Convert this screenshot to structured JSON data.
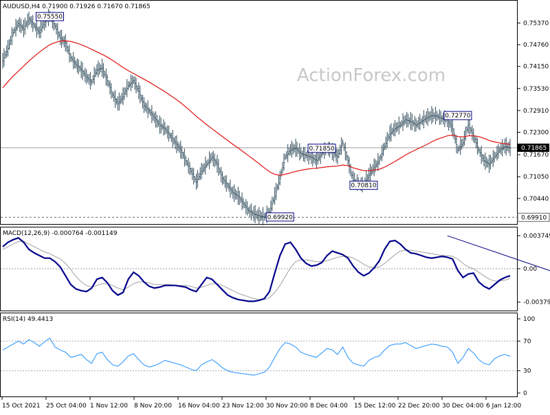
{
  "colors": {
    "bars": "#2e4a5a",
    "sma": "#e01010",
    "macd_main": "#00008b",
    "macd_signal": "#a0a0a0",
    "rsi": "#1e90ff",
    "hline": "#9a9a9a",
    "trendline": "#000080"
  },
  "watermark": "ActionForex.com",
  "chart_data": [
    {
      "type": "line",
      "title": "AUDUSD,H4  0.71900 0.71926 0.71670 0.71865",
      "x_ticks": [
        "15 Oct 2021",
        "25 Oct 04:00",
        "1 Nov 12:00",
        "8 Nov 20:00",
        "16 Nov 04:00",
        "23 Nov 12:00",
        "30 Nov 20:00",
        "8 Dec 04:00",
        "15 Dec 12:00",
        "22 Dec 20:00",
        "30 Dec 04:00",
        "6 Jan 12:00"
      ],
      "y_ticks": [
        "0.75370",
        "0.74760",
        "0.74150",
        "0.73530",
        "0.72910",
        "0.72300",
        "0.71670",
        "0.71050",
        "0.70440"
      ],
      "ylim": [
        0.698,
        0.759
      ],
      "current_price_label": "0.71865",
      "current_price": 0.71865,
      "level_label": "0.69910",
      "level": 0.6991,
      "annotations": [
        {
          "text": "0.75550",
          "x": 9,
          "y": 0.7555
        },
        {
          "text": "0.69920",
          "x": 53,
          "y": 0.6992
        },
        {
          "text": "0.71850",
          "x": 61,
          "y": 0.7185
        },
        {
          "text": "0.70810",
          "x": 69,
          "y": 0.7081
        },
        {
          "text": "0.72770",
          "x": 87,
          "y": 0.7277
        }
      ],
      "series": [
        {
          "values": [
            0.743,
            0.7465,
            0.751,
            0.7535,
            0.752,
            0.7548,
            0.753,
            0.751,
            0.754,
            0.7555,
            0.7528,
            0.7495,
            0.748,
            0.744,
            0.742,
            0.7405,
            0.7385,
            0.737,
            0.7405,
            0.741,
            0.7375,
            0.7335,
            0.731,
            0.733,
            0.736,
            0.7375,
            0.7345,
            0.7305,
            0.729,
            0.727,
            0.725,
            0.724,
            0.722,
            0.72,
            0.718,
            0.715,
            0.712,
            0.709,
            0.712,
            0.714,
            0.716,
            0.714,
            0.71,
            0.708,
            0.706,
            0.705,
            0.703,
            0.701,
            0.7,
            0.6995,
            0.6992,
            0.7005,
            0.705,
            0.71,
            0.716,
            0.718,
            0.7185,
            0.717,
            0.7165,
            0.716,
            0.715,
            0.717,
            0.7185,
            0.7175,
            0.716,
            0.72,
            0.715,
            0.7095,
            0.7085,
            0.7081,
            0.711,
            0.713,
            0.715,
            0.719,
            0.7225,
            0.724,
            0.725,
            0.7265,
            0.726,
            0.725,
            0.726,
            0.727,
            0.7277,
            0.7275,
            0.7268,
            0.7265,
            0.724,
            0.718,
            0.72,
            0.725,
            0.722,
            0.718,
            0.715,
            0.714,
            0.716,
            0.718,
            0.719,
            0.7186
          ]
        },
        {
          "values": [
            0.7355,
            0.7372,
            0.7388,
            0.7402,
            0.7416,
            0.743,
            0.7443,
            0.7455,
            0.7466,
            0.7476,
            0.7482,
            0.7486,
            0.7487,
            0.7485,
            0.7481,
            0.7476,
            0.747,
            0.7463,
            0.7456,
            0.7449,
            0.7441,
            0.7432,
            0.7422,
            0.7412,
            0.7403,
            0.7395,
            0.7387,
            0.7379,
            0.7371,
            0.7362,
            0.7353,
            0.7344,
            0.7334,
            0.7324,
            0.7313,
            0.7301,
            0.7288,
            0.7275,
            0.7263,
            0.7251,
            0.724,
            0.7229,
            0.7218,
            0.7207,
            0.7196,
            0.7186,
            0.7175,
            0.7164,
            0.7153,
            0.7142,
            0.713,
            0.7119,
            0.7112,
            0.7109,
            0.7112,
            0.7116,
            0.712,
            0.7123,
            0.7126,
            0.7128,
            0.7129,
            0.7131,
            0.7133,
            0.7134,
            0.7135,
            0.7138,
            0.7136,
            0.713,
            0.7126,
            0.7122,
            0.7122,
            0.7124,
            0.7126,
            0.7132,
            0.714,
            0.7148,
            0.7157,
            0.7166,
            0.7174,
            0.7181,
            0.7188,
            0.7195,
            0.7203,
            0.721,
            0.7215,
            0.722,
            0.7222,
            0.7218,
            0.7217,
            0.722,
            0.722,
            0.7218,
            0.7213,
            0.7207,
            0.7203,
            0.72,
            0.7198,
            0.7196
          ]
        }
      ]
    },
    {
      "type": "line",
      "title": "MACD(12,26,9) -0.000764 -0.001149",
      "y_ticks": [
        "0.003749",
        "0.00",
        "-0.003796"
      ],
      "ylim": [
        -0.0046,
        0.0043
      ],
      "trendline": [
        {
          "x": 85,
          "y": 0.00375
        },
        {
          "x": 106,
          "y": -0.0005
        }
      ],
      "series": [
        {
          "values": [
            0.0025,
            0.003,
            0.0033,
            0.0035,
            0.003,
            0.0022,
            0.0018,
            0.0015,
            0.0012,
            0.0012,
            0.0008,
            0.0002,
            -0.0008,
            -0.0018,
            -0.0023,
            -0.0025,
            -0.0026,
            -0.0022,
            -0.0012,
            -0.001,
            -0.0016,
            -0.0025,
            -0.003,
            -0.0027,
            -0.0012,
            -0.0004,
            -0.0008,
            -0.0015,
            -0.002,
            -0.0022,
            -0.0021,
            -0.0019,
            -0.0019,
            -0.0019,
            -0.002,
            -0.0021,
            -0.0024,
            -0.0026,
            -0.0018,
            -0.001,
            -0.0012,
            -0.0018,
            -0.0024,
            -0.003,
            -0.0033,
            -0.0035,
            -0.0036,
            -0.0037,
            -0.0037,
            -0.0036,
            -0.0034,
            -0.0026,
            -0.0005,
            0.0015,
            0.0028,
            0.003,
            0.0022,
            0.0012,
            0.0006,
            0.0003,
            0.0004,
            0.0007,
            0.0015,
            0.002,
            0.0018,
            0.0016,
            0.0012,
            0.0003,
            -0.0004,
            -0.0008,
            -0.0005,
            0.0001,
            0.0009,
            0.0022,
            0.0031,
            0.0032,
            0.0028,
            0.0022,
            0.0018,
            0.0017,
            0.0015,
            0.0013,
            0.0012,
            0.0013,
            0.0014,
            0.0013,
            0.0011,
            -0.0002,
            -0.001,
            -0.0006,
            -0.0005,
            -0.0015,
            -0.002,
            -0.0023,
            -0.0018,
            -0.0013,
            -0.001,
            -0.0008
          ]
        },
        {
          "values": [
            0.0022,
            0.0025,
            0.0028,
            0.0031,
            0.0031,
            0.0028,
            0.0025,
            0.0022,
            0.0019,
            0.0017,
            0.0014,
            0.0011,
            0.0006,
            -0.0001,
            -0.0009,
            -0.0015,
            -0.0019,
            -0.0021,
            -0.0019,
            -0.0017,
            -0.0017,
            -0.0019,
            -0.0022,
            -0.0024,
            -0.0021,
            -0.0017,
            -0.0015,
            -0.0015,
            -0.0016,
            -0.0018,
            -0.0018,
            -0.0018,
            -0.0018,
            -0.0019,
            -0.0019,
            -0.0019,
            -0.002,
            -0.0022,
            -0.0021,
            -0.0019,
            -0.0017,
            -0.0017,
            -0.0019,
            -0.0022,
            -0.0025,
            -0.0028,
            -0.003,
            -0.0032,
            -0.0034,
            -0.0035,
            -0.0035,
            -0.0033,
            -0.0027,
            -0.0019,
            -0.0009,
            0.0001,
            0.0008,
            0.001,
            0.001,
            0.0009,
            0.0008,
            0.0008,
            0.0009,
            0.0011,
            0.0013,
            0.0014,
            0.0014,
            0.0012,
            0.0009,
            0.0005,
            0.0002,
            0.0001,
            0.0002,
            0.0006,
            0.0011,
            0.0016,
            0.002,
            0.0021,
            0.0021,
            0.002,
            0.0019,
            0.0018,
            0.0017,
            0.0016,
            0.0015,
            0.0015,
            0.0014,
            0.0011,
            0.0006,
            0.0002,
            0.0,
            -0.0004,
            -0.0008,
            -0.0012,
            -0.0014,
            -0.0014,
            -0.0013,
            -0.0011
          ]
        }
      ]
    },
    {
      "type": "line",
      "title": "RSI(14) 49.4413",
      "y_ticks": [
        "100",
        "70",
        "30",
        "0"
      ],
      "ylim": [
        0,
        100
      ],
      "levels": [
        70,
        30
      ],
      "series": [
        {
          "values": [
            58,
            62,
            66,
            70,
            66,
            72,
            68,
            63,
            69,
            74,
            62,
            58,
            55,
            48,
            50,
            52,
            45,
            40,
            53,
            55,
            45,
            38,
            36,
            42,
            50,
            53,
            45,
            38,
            35,
            37,
            40,
            44,
            42,
            40,
            38,
            35,
            32,
            30,
            38,
            42,
            45,
            40,
            34,
            30,
            28,
            27,
            26,
            25,
            24,
            26,
            28,
            35,
            48,
            60,
            68,
            66,
            62,
            55,
            52,
            50,
            48,
            54,
            60,
            58,
            52,
            62,
            48,
            40,
            38,
            36,
            44,
            48,
            50,
            58,
            64,
            66,
            66,
            68,
            64,
            60,
            62,
            64,
            66,
            65,
            63,
            62,
            55,
            40,
            48,
            60,
            54,
            45,
            40,
            38,
            46,
            50,
            52,
            49.4413
          ]
        }
      ]
    }
  ]
}
